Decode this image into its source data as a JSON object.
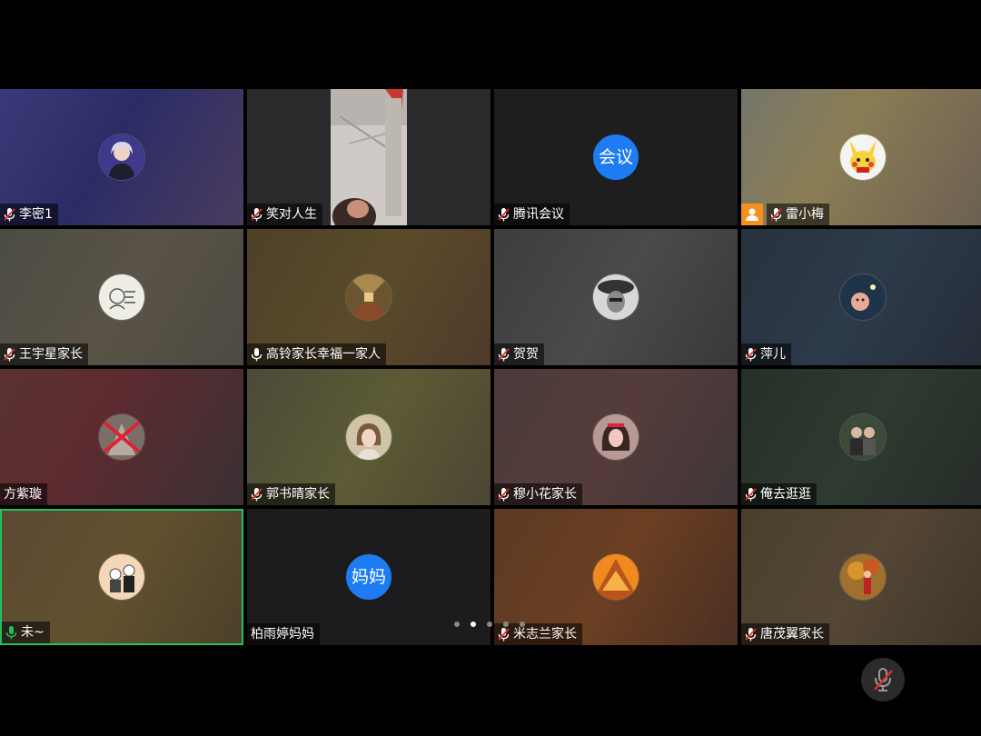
{
  "participants": [
    {
      "name": "李密1",
      "mic": "muted",
      "avatar": "photo-woman-icon",
      "bg": "linear-gradient(120deg,#3a3a78,#2b2c66 45%,#4a3d5e)"
    },
    {
      "name": "笑对人生",
      "mic": "muted",
      "avatar": "video",
      "bg": "#2a2a2c"
    },
    {
      "name": "腾讯会议",
      "mic": "muted",
      "avatar_text": "会议",
      "bg": "#1e1e20"
    },
    {
      "name": "雷小梅",
      "mic": "muted",
      "host": true,
      "avatar": "pikachu-icon",
      "bg": "linear-gradient(120deg,#75766a,#8a7d55 40%,#6b5f52)"
    },
    {
      "name": "王宇星家长",
      "mic": "muted",
      "avatar": "cartoon-sketch-icon",
      "bg": "linear-gradient(120deg,#4c4c44,#5a5347 50%,#4d4a42)"
    },
    {
      "name": "高铃家长幸福一家人",
      "mic": "on-white",
      "avatar": "photo-hallway-icon",
      "bg": "linear-gradient(120deg,#4d4128,#5b4a2a 50%,#4f3a2b)"
    },
    {
      "name": "贺贺",
      "mic": "muted",
      "avatar": "photo-bw-face-icon",
      "bg": "linear-gradient(120deg,#3d3d3f,#4a4a4a 50%,#39393a)"
    },
    {
      "name": "萍儿",
      "mic": "muted",
      "avatar": "photo-toy-icon",
      "bg": "linear-gradient(120deg,#28323e,#2d3a4a 50%,#262d38)"
    },
    {
      "name": "方紫璇",
      "mic": "none",
      "avatar": "photo-cat-icon",
      "bg": "linear-gradient(120deg,#5b3231,#5c2b30 40%,#3a3032)"
    },
    {
      "name": "郭书晴家长",
      "mic": "muted",
      "avatar": "photo-girl-icon",
      "bg": "linear-gradient(120deg,#4b4a38,#5c5b35 50%,#4b4633)"
    },
    {
      "name": "穆小花家长",
      "mic": "muted",
      "avatar": "photo-woman-hair-icon",
      "bg": "linear-gradient(120deg,#4d3a3b,#553c3b 50%,#3f3638)"
    },
    {
      "name": "俺去逛逛",
      "mic": "muted",
      "avatar": "photo-couple-icon",
      "bg": "linear-gradient(120deg,#273028,#2e3a30 50%,#262c28)"
    },
    {
      "name": "未~",
      "mic": "on-green",
      "active": true,
      "avatar": "cartoon-figures-icon",
      "bg": "linear-gradient(120deg,#5b4a33,#62512f 50%,#4b4029)"
    },
    {
      "name": "柏雨婷妈妈",
      "mic": "none",
      "avatar_text": "妈妈",
      "bg": "#1c1c1e"
    },
    {
      "name": "米志兰家长",
      "mic": "muted",
      "avatar": "photo-orange-icon",
      "bg": "linear-gradient(120deg,#5c3a22,#6b3f22 50%,#4a2f22)"
    },
    {
      "name": "唐茂翼家长",
      "mic": "muted",
      "avatar": "photo-autumn-icon",
      "bg": "linear-gradient(120deg,#4a3f2c,#544635 50%,#3f3528)"
    }
  ],
  "pager": {
    "count": 5,
    "active": 1
  },
  "colors": {
    "active_border": "#22c15e",
    "host_badge": "#f5901e",
    "muted_red": "#e0312b",
    "text_avatar": "#1d7cf2"
  }
}
